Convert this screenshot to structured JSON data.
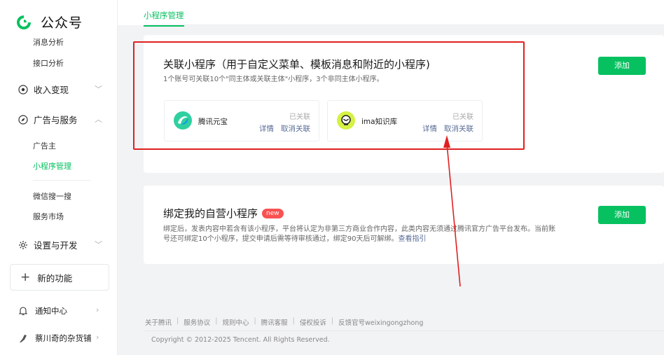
{
  "sidebar": {
    "logo_text": "公众号",
    "items": {
      "msg_analysis": "消息分析",
      "api_analysis": "接口分析",
      "income": "收入变现",
      "ads": "广告与服务",
      "advertiser": "广告主",
      "mini_program_mgmt": "小程序管理",
      "wechat_search": "微信搜一搜",
      "service_market": "服务市场",
      "settings_dev": "设置与开发",
      "new_features": "新的功能",
      "notify_center": "通知中心",
      "account_name": "蔡川奇的杂货铺"
    }
  },
  "tabs": {
    "active": "小程序管理"
  },
  "section1": {
    "title": "关联小程序（用于自定义菜单、模板消息和附近的小程序)",
    "desc": "1个账号可关联10个\"同主体或关联主体\"小程序，3个非同主体小程序。",
    "add_label": "添加",
    "mini_programs": [
      {
        "name": "腾讯元宝",
        "status": "已关联",
        "detail": "详情",
        "unlink": "取消关联"
      },
      {
        "name": "ima知识库",
        "status": "已关联",
        "detail": "详情",
        "unlink": "取消关联"
      }
    ]
  },
  "section2": {
    "title": "绑定我的自营小程序",
    "badge": "new",
    "desc_line1": "绑定后，发表内容中若含有该小程序，平台将认定为非第三方商业合作内容，此类内容无须通过腾讯官方广告平台发布。当前账",
    "desc_line2": "号还可绑定10个小程序，提交申请后需等待审核通过，绑定90天后可解绑。",
    "guide_link": "查看指引",
    "add_label": "添加"
  },
  "footer": {
    "links": [
      "关于腾讯",
      "服务协议",
      "规则中心",
      "腾讯客服",
      "侵权投诉",
      "反馈官号weixingongzhong"
    ],
    "copyright": "Copyright © 2012-2025 Tencent. All Rights Reserved."
  },
  "colors": {
    "accent": "#07c160",
    "link": "#576b95",
    "annotation": "#e02020",
    "badge": "#fa5151"
  }
}
